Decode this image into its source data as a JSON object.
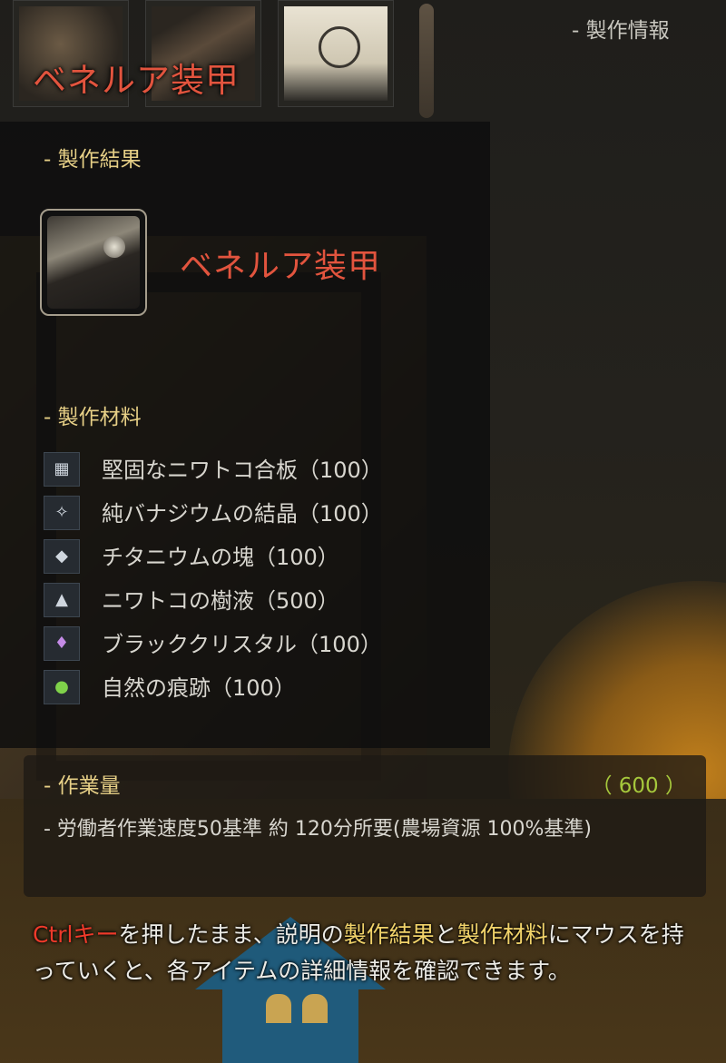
{
  "header": {
    "section_label": "- 製作情報",
    "item_title": "ベネルア装甲"
  },
  "result": {
    "heading": "- 製作結果",
    "name": "ベネルア装甲"
  },
  "materials": {
    "heading": "- 製作材料",
    "items": [
      {
        "icon": "plywood-icon",
        "label": "堅固なニワトコ合板（100）"
      },
      {
        "icon": "crystal-icon",
        "label": "純バナジウムの結晶（100）"
      },
      {
        "icon": "ingot-icon",
        "label": "チタニウムの塊（100）"
      },
      {
        "icon": "sap-icon",
        "label": "ニワトコの樹液（500）"
      },
      {
        "icon": "black-crystal-icon",
        "label": "ブラッククリスタル（100）"
      },
      {
        "icon": "nature-trace-icon",
        "label": "自然の痕跡（100）"
      }
    ]
  },
  "work": {
    "heading": "- 作業量",
    "value": "（ 600 ）",
    "description": "- 労働者作業速度50基準 約 120分所要(農場資源 100%基準)"
  },
  "hint": {
    "ctrl_key": "Ctrlキー",
    "part1": "を押したまま、説明の",
    "result_word": "製作結果",
    "and": "と",
    "materials_word": "製作材料",
    "part2": "にマウスを持っていくと、各アイテムの詳細情報を確認できます。"
  },
  "colors": {
    "item_name": "#e2543e",
    "section_heading": "#e6cf86",
    "work_value": "#a6c83c",
    "ctrl_key": "#ee3a2a"
  }
}
